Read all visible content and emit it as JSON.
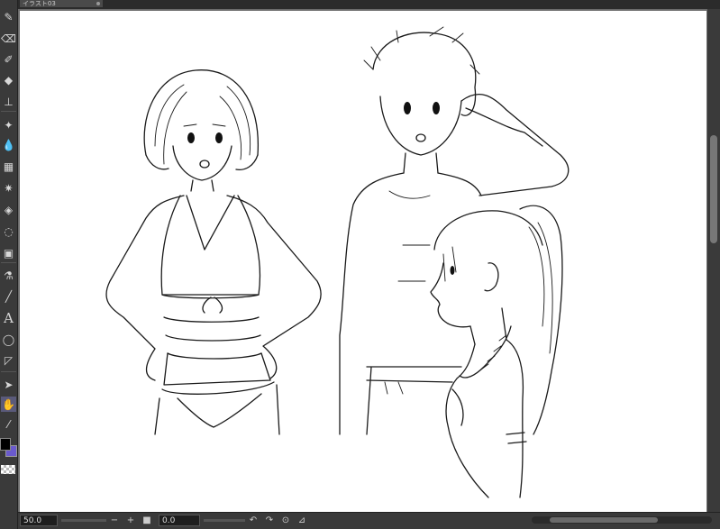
{
  "document_tab": {
    "title": "イラスト03"
  },
  "tools": [
    {
      "name": "pen-icon",
      "glyph": "✎"
    },
    {
      "name": "eraser-icon",
      "glyph": "⌫"
    },
    {
      "name": "brush-icon",
      "glyph": "✐"
    },
    {
      "name": "fill-bucket-icon",
      "glyph": "◆"
    },
    {
      "name": "stamp-icon",
      "glyph": "⊥"
    },
    {
      "name": "sparkle-icon",
      "glyph": "✦"
    },
    {
      "name": "blend-icon",
      "glyph": "💧"
    },
    {
      "name": "frame-icon",
      "glyph": "▦"
    },
    {
      "name": "burst-icon",
      "glyph": "✷"
    },
    {
      "name": "paint-bucket-icon",
      "glyph": "◈"
    },
    {
      "name": "lasso-icon",
      "glyph": "◌"
    },
    {
      "name": "gradient-icon",
      "glyph": "▣"
    },
    {
      "name": "eyedropper-icon",
      "glyph": "⚗"
    },
    {
      "name": "line-icon",
      "glyph": "╱"
    },
    {
      "name": "text-icon",
      "glyph": "A"
    },
    {
      "name": "ellipse-icon",
      "glyph": "◯"
    },
    {
      "name": "ruler-icon",
      "glyph": "◸"
    },
    {
      "name": "select-arrow-icon",
      "glyph": "➤"
    },
    {
      "name": "hand-icon",
      "glyph": "✋"
    },
    {
      "name": "eyedropper-2-icon",
      "glyph": "⁄"
    }
  ],
  "status": {
    "zoom": "50.0",
    "zoom_out": "−",
    "zoom_in": "+",
    "fit": "■",
    "angle": "0.0",
    "rotate_left": "↶",
    "rotate_right": "↷",
    "reset_rotation": "⊙",
    "flip": "⊿"
  }
}
